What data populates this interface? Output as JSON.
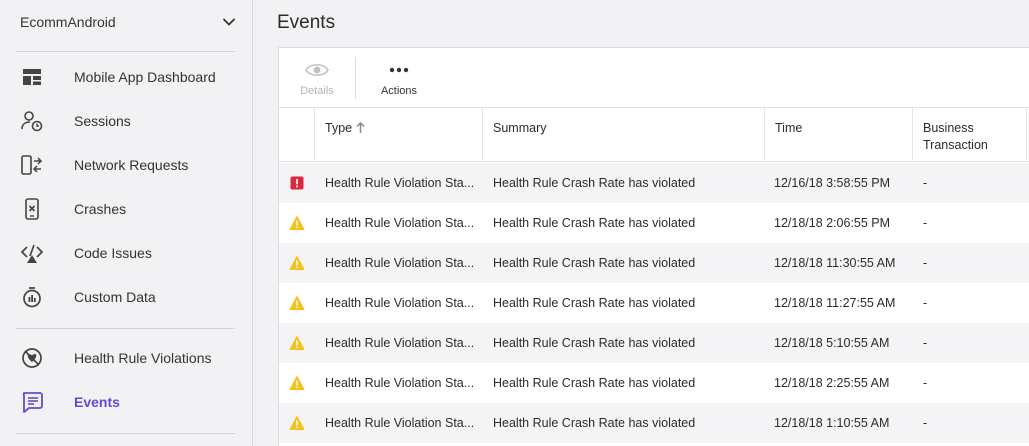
{
  "sidebar": {
    "app_name": "EcommAndroid",
    "groups": [
      [
        {
          "label": "Mobile App Dashboard",
          "icon": "dashboard-icon"
        },
        {
          "label": "Sessions",
          "icon": "sessions-icon"
        },
        {
          "label": "Network Requests",
          "icon": "network-requests-icon"
        },
        {
          "label": "Crashes",
          "icon": "crashes-icon"
        },
        {
          "label": "Code Issues",
          "icon": "code-issues-icon"
        },
        {
          "label": "Custom Data",
          "icon": "custom-data-icon"
        }
      ],
      [
        {
          "label": "Health Rule Violations",
          "icon": "health-rule-icon"
        },
        {
          "label": "Events",
          "icon": "events-icon",
          "active": true
        }
      ]
    ]
  },
  "main": {
    "title": "Events",
    "toolbar": {
      "details_label": "Details",
      "actions_label": "Actions"
    },
    "columns": {
      "type": "Type",
      "summary": "Summary",
      "time": "Time",
      "business_transaction": "Business Transaction"
    },
    "rows": [
      {
        "severity": "critical",
        "type": "Health Rule Violation Sta...",
        "summary": "Health Rule Crash Rate has violated",
        "time": "12/16/18 3:58:55 PM",
        "bt": "-"
      },
      {
        "severity": "warning",
        "type": "Health Rule Violation Sta...",
        "summary": "Health Rule Crash Rate has violated",
        "time": "12/18/18 2:06:55 PM",
        "bt": "-"
      },
      {
        "severity": "warning",
        "type": "Health Rule Violation Sta...",
        "summary": "Health Rule Crash Rate has violated",
        "time": "12/18/18 11:30:55 AM",
        "bt": "-"
      },
      {
        "severity": "warning",
        "type": "Health Rule Violation Sta...",
        "summary": "Health Rule Crash Rate has violated",
        "time": "12/18/18 11:27:55 AM",
        "bt": "-"
      },
      {
        "severity": "warning",
        "type": "Health Rule Violation Sta...",
        "summary": "Health Rule Crash Rate has violated",
        "time": "12/18/18 5:10:55 AM",
        "bt": "-"
      },
      {
        "severity": "warning",
        "type": "Health Rule Violation Sta...",
        "summary": "Health Rule Crash Rate has violated",
        "time": "12/18/18 2:25:55 AM",
        "bt": "-"
      },
      {
        "severity": "warning",
        "type": "Health Rule Violation Sta...",
        "summary": "Health Rule Crash Rate has violated",
        "time": "12/18/18 1:10:55 AM",
        "bt": "-"
      }
    ]
  },
  "colors": {
    "accent": "#5c4ed1",
    "critical": "#e0263c",
    "warning": "#f5c21b"
  }
}
